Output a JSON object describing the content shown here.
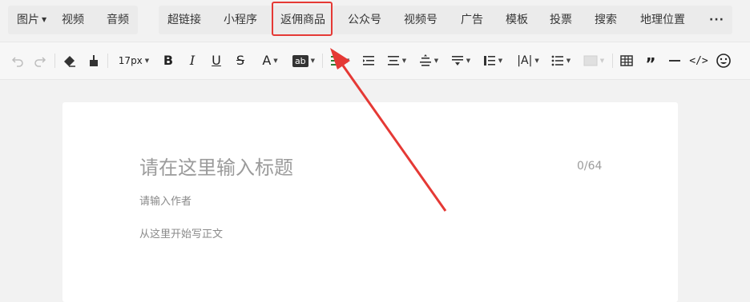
{
  "insert_bar": {
    "left_group": [
      {
        "label": "图片",
        "has_dropdown": true
      },
      {
        "label": "视频",
        "has_dropdown": false
      },
      {
        "label": "音频",
        "has_dropdown": false
      }
    ],
    "right_group": [
      {
        "label": "超链接"
      },
      {
        "label": "小程序"
      },
      {
        "label": "返佣商品",
        "highlighted": true
      },
      {
        "label": "公众号"
      },
      {
        "label": "视频号"
      },
      {
        "label": "广告"
      },
      {
        "label": "模板"
      },
      {
        "label": "投票"
      },
      {
        "label": "搜索"
      },
      {
        "label": "地理位置"
      },
      {
        "label": "···"
      }
    ]
  },
  "format_toolbar": {
    "font_size": "17px",
    "bold": "B",
    "italic": "I",
    "underline": "U",
    "strikethrough": "S",
    "font_color": "A",
    "background_color": "ab"
  },
  "editor": {
    "title_placeholder": "请在这里输入标题",
    "title_counter": "0/64",
    "author_placeholder": "请输入作者",
    "body_placeholder": "从这里开始写正文"
  },
  "colors": {
    "highlight_box": "#e53935",
    "arrow": "#e53935",
    "toolbar_bg": "#f7f7f7",
    "canvas_bg": "#ffffff",
    "page_bg": "#f2f2f2"
  }
}
